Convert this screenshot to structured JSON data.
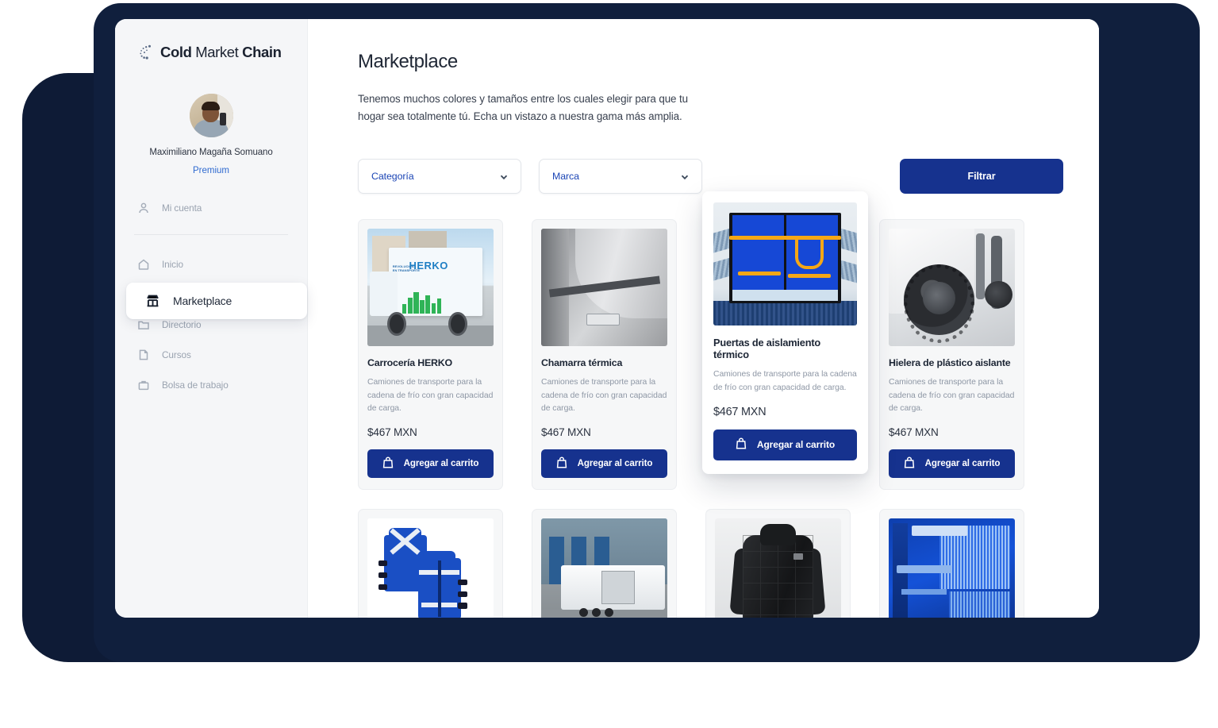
{
  "brand": {
    "name_part1": "Cold",
    "name_part2": "Market",
    "name_part3": "Chain",
    "logo_icon": "snowflake-dots-icon"
  },
  "sidebar": {
    "user": {
      "name": "Maximiliano Magaña Somuano",
      "plan": "Premium",
      "avatar_alt": "user-avatar"
    },
    "account_item": {
      "label": "Mi cuenta",
      "icon": "person-icon"
    },
    "items": [
      {
        "label": "Inicio",
        "icon": "home-icon",
        "active": false
      },
      {
        "label": "Marketplace",
        "icon": "store-icon",
        "active": true
      },
      {
        "label": "Directorio",
        "icon": "folder-icon",
        "active": false
      },
      {
        "label": "Cursos",
        "icon": "book-icon",
        "active": false
      },
      {
        "label": "Bolsa de trabajo",
        "icon": "briefcase-icon",
        "active": false
      }
    ]
  },
  "main": {
    "title": "Marketplace",
    "subtitle": "Tenemos muchos colores y tamaños entre los cuales elegir para que tu hogar sea totalmente tú.  Echa un vistazo a nuestra gama más amplia."
  },
  "filters": {
    "category": {
      "label": "Categoría",
      "icon": "chevron-down-icon"
    },
    "brand": {
      "label": "Marca",
      "icon": "chevron-down-icon"
    },
    "submit": "Filtrar"
  },
  "products": [
    {
      "title": "Carrocería HERKO",
      "description": "Camiones de transporte para la cadena de frío con gran capacidad de carga.",
      "price": "$467 MXN",
      "button": "Agregar al carrito",
      "button_icon": "shopping-bag-icon",
      "image": "truck-herko"
    },
    {
      "title": "Chamarra térmica",
      "description": "Camiones de transporte para la cadena de frío con gran capacidad de carga.",
      "price": "$467 MXN",
      "button": "Agregar al carrito",
      "button_icon": "shopping-bag-icon",
      "image": "thermal-curtain"
    },
    {
      "title": "Puertas de aislamiento térmico",
      "description": "Camiones de transporte para la cadena de frío con gran capacidad de carga.",
      "price": "$467 MXN",
      "button": "Agregar al carrito",
      "button_icon": "shopping-bag-icon",
      "image": "insulation-doors",
      "hovered": true
    },
    {
      "title": "Hielera de plástico aislante",
      "description": "Camiones de transporte para la cadena de frío con gran capacidad de carga.",
      "price": "$467 MXN",
      "button": "Agregar al carrito",
      "button_icon": "shopping-bag-icon",
      "image": "cooler-wheels"
    }
  ],
  "products_row2": [
    {
      "image": "safety-vest"
    },
    {
      "image": "refrigerated-trailer"
    },
    {
      "image": "black-jacket"
    },
    {
      "image": "blue-condenser"
    }
  ],
  "colors": {
    "primary_navy": "#16328e",
    "link_blue": "#2f6ad0",
    "frame_dark": "#0e1b36",
    "sidebar_bg": "#f5f6f8",
    "card_bg": "#f6f7f8"
  }
}
